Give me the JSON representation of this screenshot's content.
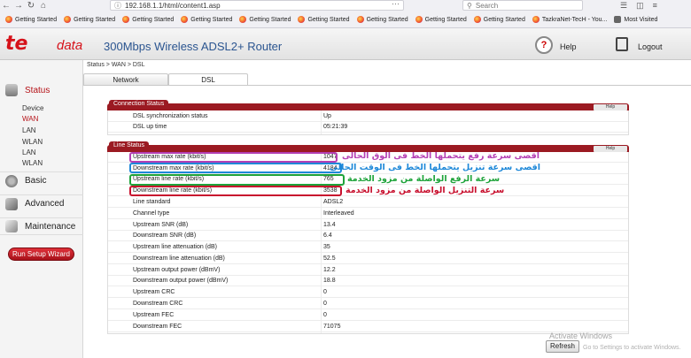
{
  "browser": {
    "url": "192.168.1.1/html/content1.asp",
    "search_placeholder": "Search",
    "bookmarks": [
      "Getting Started",
      "Getting Started",
      "Getting Started",
      "Getting Started",
      "Getting Started",
      "Getting Started",
      "Getting Started",
      "Getting Started",
      "Getting Started",
      "TazkraNet-TecH - You...",
      "Most Visited"
    ]
  },
  "header": {
    "logo_te": "te",
    "logo_data": "data",
    "title": "300Mbps Wireless ADSL2+ Router",
    "help_label": "Help",
    "logout_label": "Logout"
  },
  "breadcrumb": "Status > WAN > DSL",
  "tabs": {
    "network": "Network",
    "dsl": "DSL"
  },
  "sidebar": {
    "status": "Status",
    "status_items": [
      "Device",
      "WAN",
      "LAN",
      "WLAN",
      "LAN",
      "WLAN"
    ],
    "basic": "Basic",
    "advanced": "Advanced",
    "maintenance": "Maintenance",
    "wizard": "Run Setup Wizard"
  },
  "connection_status": {
    "title": "Connection Status",
    "help": "Help",
    "rows": [
      {
        "label": "DSL synchronization status",
        "value": "Up"
      },
      {
        "label": "DSL up time",
        "value": "05:21:39"
      }
    ]
  },
  "line_status": {
    "title": "Line Status",
    "help": "Help",
    "rows": [
      {
        "label": "Upstream max rate (kbit/s)",
        "value": "1047"
      },
      {
        "label": "Downstream max rate (kbit/s)",
        "value": "4184"
      },
      {
        "label": "Upstream line rate (kbit/s)",
        "value": "765"
      },
      {
        "label": "Downstream line rate (kbit/s)",
        "value": "3538"
      },
      {
        "label": "Line standard",
        "value": "ADSL2"
      },
      {
        "label": "Channel type",
        "value": "Interleaved"
      },
      {
        "label": "Upstream SNR (dB)",
        "value": "13.4"
      },
      {
        "label": "Downstream SNR (dB)",
        "value": "6.4"
      },
      {
        "label": "Upstream line attenuation (dB)",
        "value": "35"
      },
      {
        "label": "Downstream line attenuation (dB)",
        "value": "52.5"
      },
      {
        "label": "Upstream output power (dBmV)",
        "value": "12.2"
      },
      {
        "label": "Downstream output power (dBmV)",
        "value": "18.8"
      },
      {
        "label": "Upstream CRC",
        "value": "0"
      },
      {
        "label": "Downstream CRC",
        "value": "0"
      },
      {
        "label": "Upstream FEC",
        "value": "0"
      },
      {
        "label": "Downstream FEC",
        "value": "71075"
      }
    ]
  },
  "annotations": {
    "upstream_max": "اقصى سرعة رفع يتحملها الخط فى الوق الحالى",
    "downstream_max": "اقصى سرعة تنزيل يتحملها الخط فى الوقت الحالى",
    "upstream_line": "سرعة الرفع الواصلة من مزود الخدمة",
    "downstream_line": "سرعة التنزيل الواصلة من مزود الخدمة",
    "colors": {
      "upstream_max": "#b43fb4",
      "downstream_max": "#1e88d8",
      "upstream_line": "#1ea33a",
      "downstream_line": "#c8102e"
    }
  },
  "refresh": "Refresh",
  "watermark": {
    "line1": "Activate Windows",
    "line2": "Go to Settings to activate Windows."
  }
}
